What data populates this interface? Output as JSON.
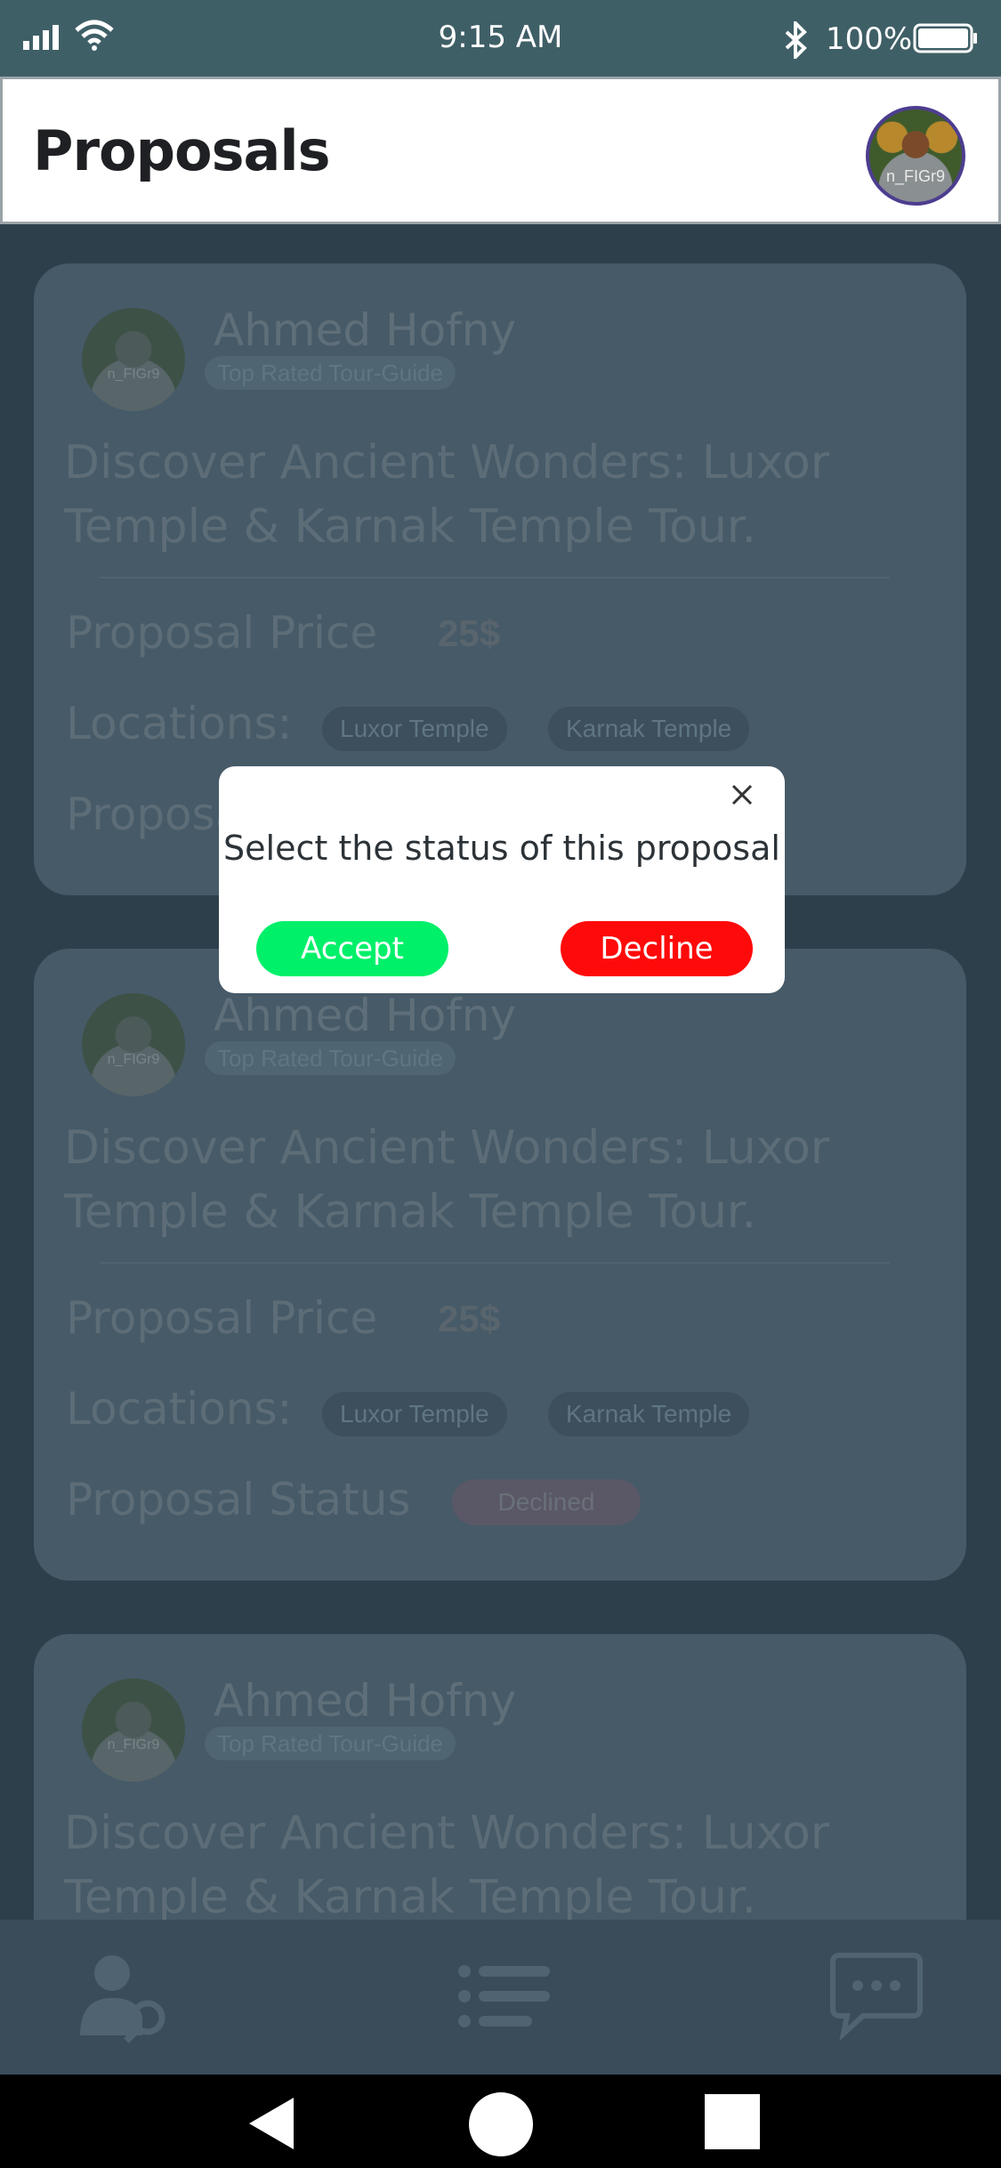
{
  "status_bar": {
    "time": "9:15 AM",
    "battery": "100%",
    "icons": [
      "signal-icon",
      "wifi-icon",
      "bluetooth-icon",
      "battery-icon"
    ]
  },
  "header": {
    "title": "Proposals",
    "avatar_watermark": "n_FIGr9"
  },
  "cards": [
    {
      "avatar_watermark": "n_FIGr9",
      "name": "Ahmed Hofny",
      "badge": "Top Rated Tour-Guide",
      "title": "Discover Ancient Wonders: Luxor Temple & Karnak Temple Tour.",
      "price_label": "Proposal Price",
      "price": "25$",
      "locations_label": "Locations:",
      "locations": [
        "Luxor Temple",
        "Karnak Temple"
      ],
      "status_label": "Proposal Status",
      "status": ""
    },
    {
      "avatar_watermark": "n_FIGr9",
      "name": "Ahmed Hofny",
      "badge": "Top Rated Tour-Guide",
      "title": "Discover Ancient Wonders: Luxor Temple & Karnak Temple Tour.",
      "price_label": "Proposal Price",
      "price": "25$",
      "locations_label": "Locations:",
      "locations": [
        "Luxor Temple",
        "Karnak Temple"
      ],
      "status_label": "Proposal Status",
      "status": "Declined"
    },
    {
      "avatar_watermark": "n_FIGr9",
      "name": "Ahmed Hofny",
      "badge": "Top Rated Tour-Guide",
      "title": "Discover Ancient Wonders: Luxor Temple & Karnak Temple Tour."
    }
  ],
  "bottom_nav": {
    "icons": [
      "guide-search-icon",
      "list-icon",
      "chat-icon"
    ]
  },
  "modal": {
    "prompt": "Select the status of this proposal",
    "accept_label": "Accept",
    "decline_label": "Decline",
    "accept_color": "#00f06a",
    "decline_color": "#ff0a0a"
  },
  "colors": {
    "status_bar": "#3f5f66",
    "overlay_bg": "#2e3f4c",
    "card_bg": "#465a68"
  }
}
